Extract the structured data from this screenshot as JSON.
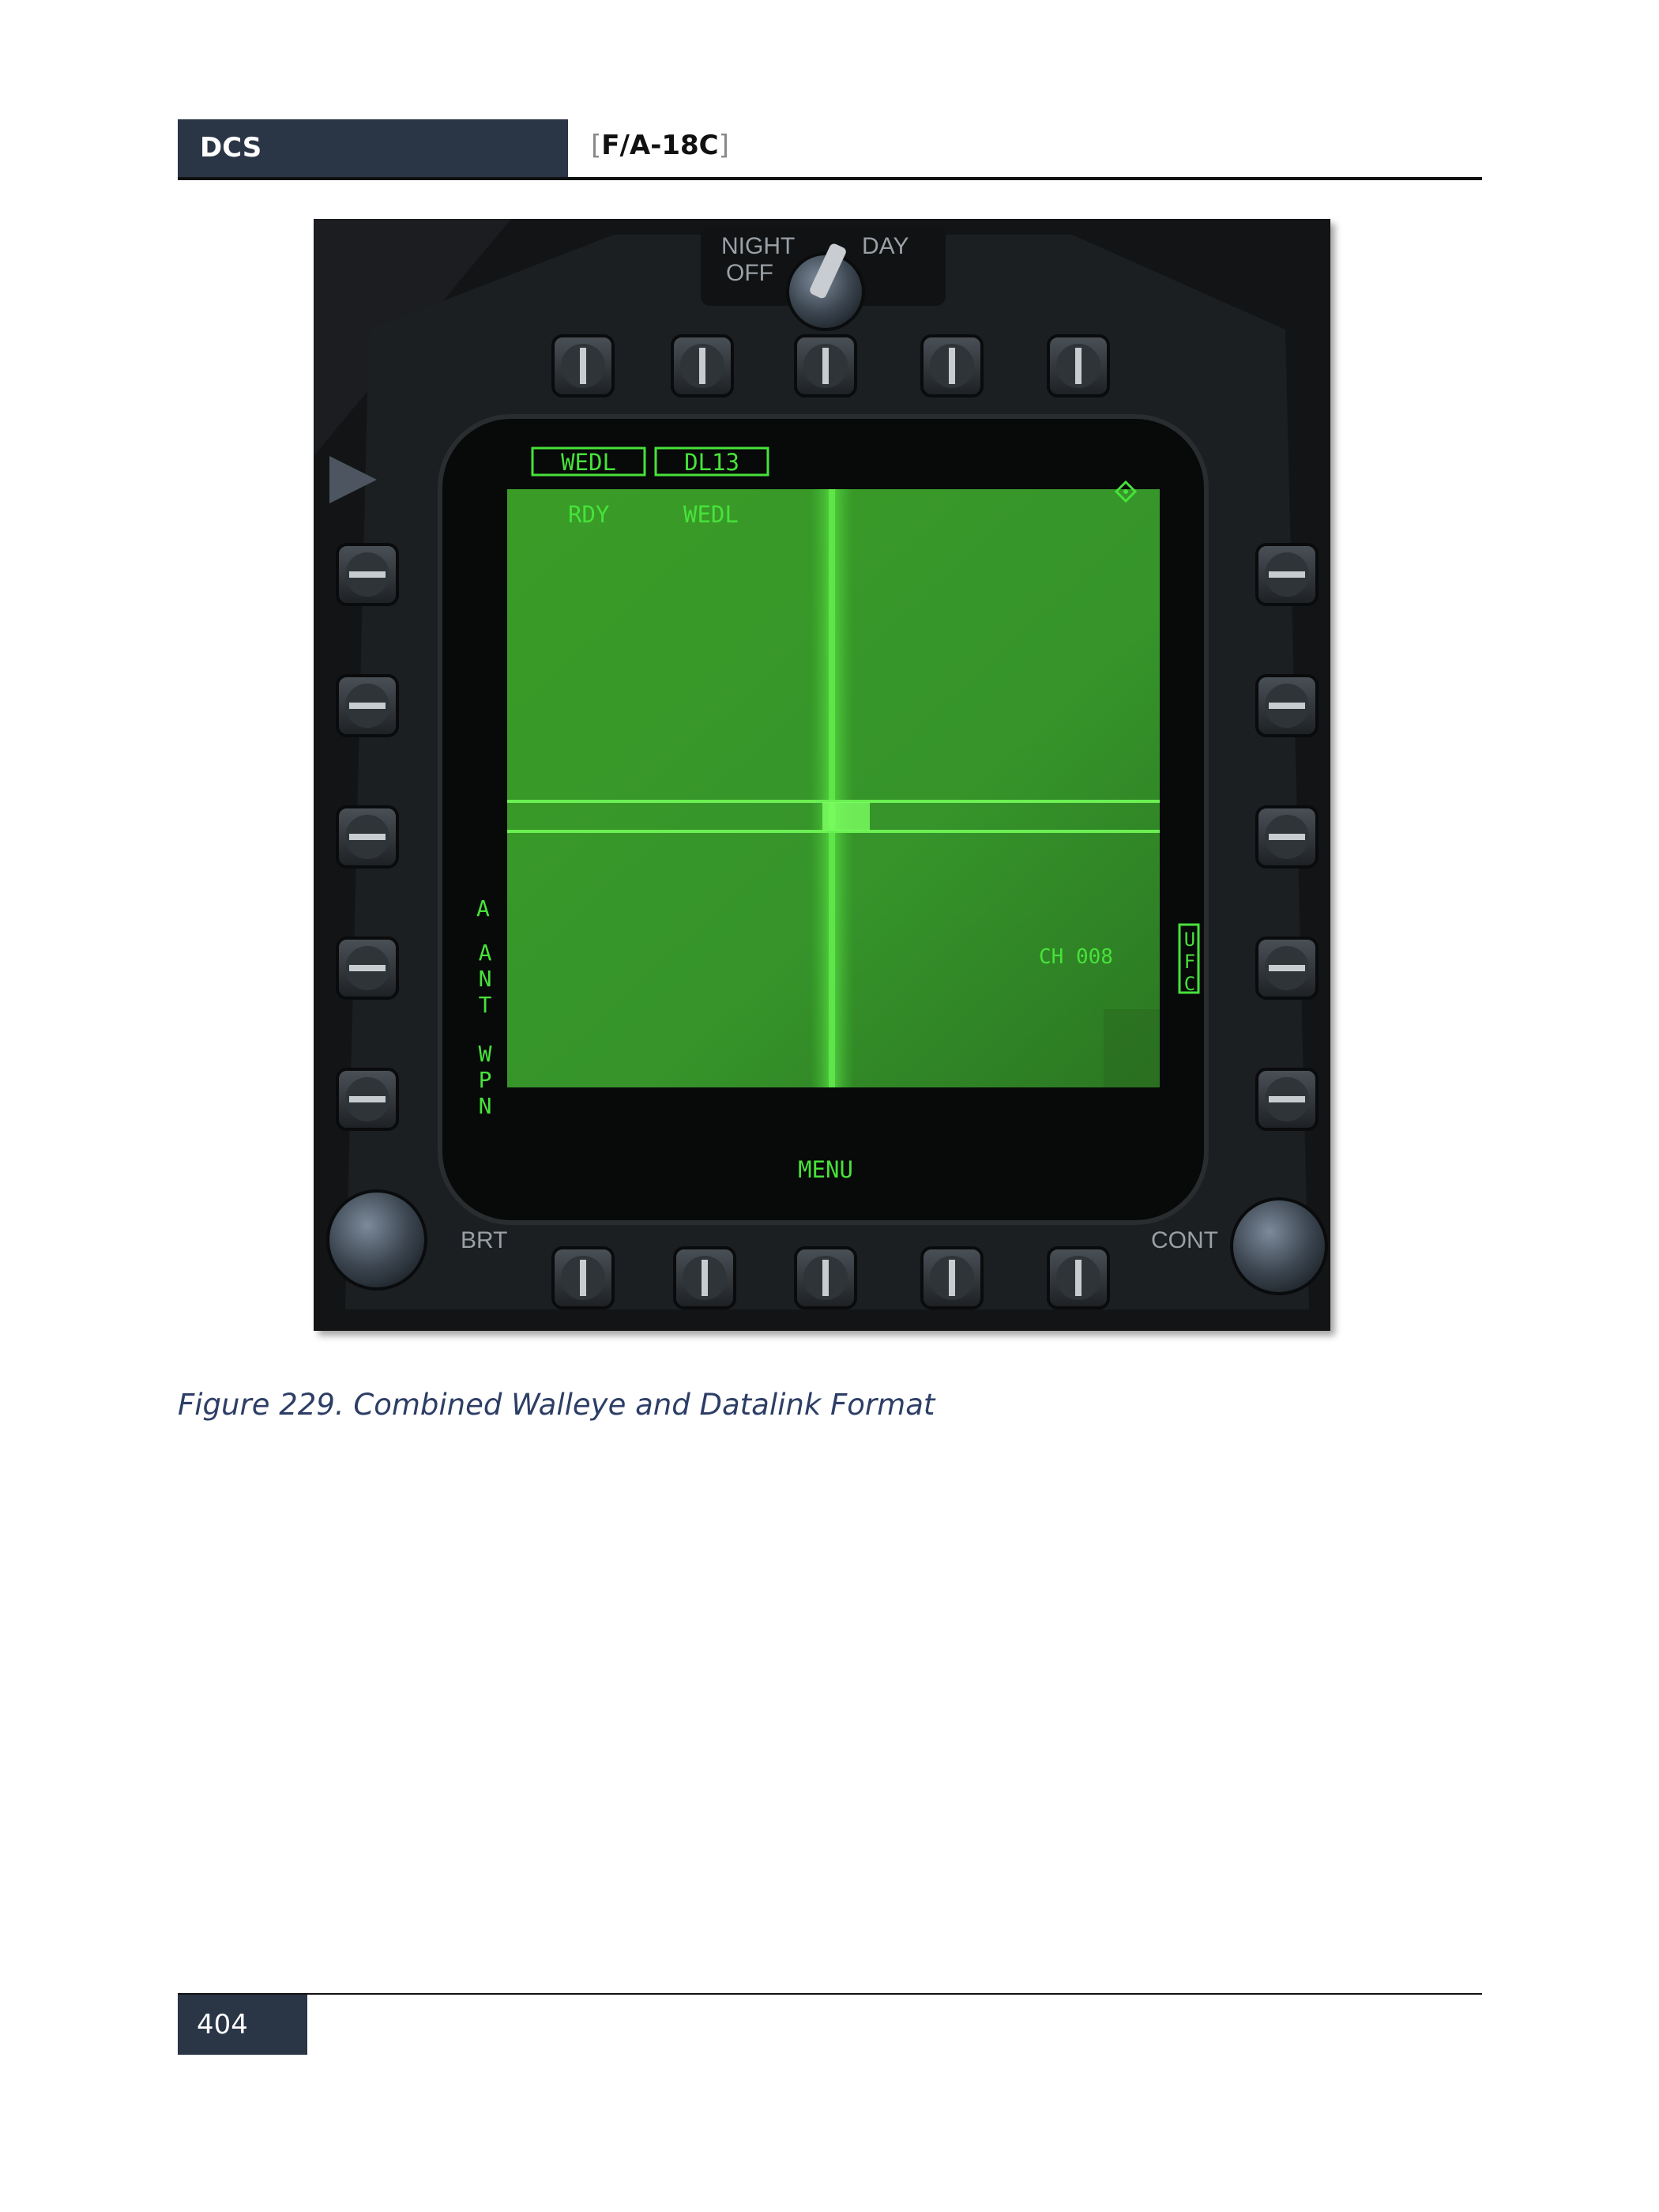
{
  "header": {
    "left_label": "DCS",
    "bracket_open": "[",
    "title": "F/A-18C",
    "bracket_close": "]"
  },
  "figure": {
    "bezel": {
      "knob_night": "NIGHT",
      "knob_off": "OFF",
      "knob_day": "DAY",
      "brt": "BRT",
      "cont": "CONT"
    },
    "display": {
      "top_box_1": "WEDL",
      "top_box_2": "DL13",
      "status_left": "RDY",
      "status_right": "WEDL",
      "left_a": "A",
      "left_ant": "ANT",
      "left_wpn": "WPN",
      "right_ufc": "UFC",
      "channel": "CH 008",
      "menu": "MENU"
    },
    "colors": {
      "symbology": "#47e23a",
      "video": "#3ea12a",
      "bezel": "#1a1c1e"
    }
  },
  "caption": "Figure 229. Combined Walleye and Datalink Format",
  "footer": {
    "page_number": "404"
  }
}
